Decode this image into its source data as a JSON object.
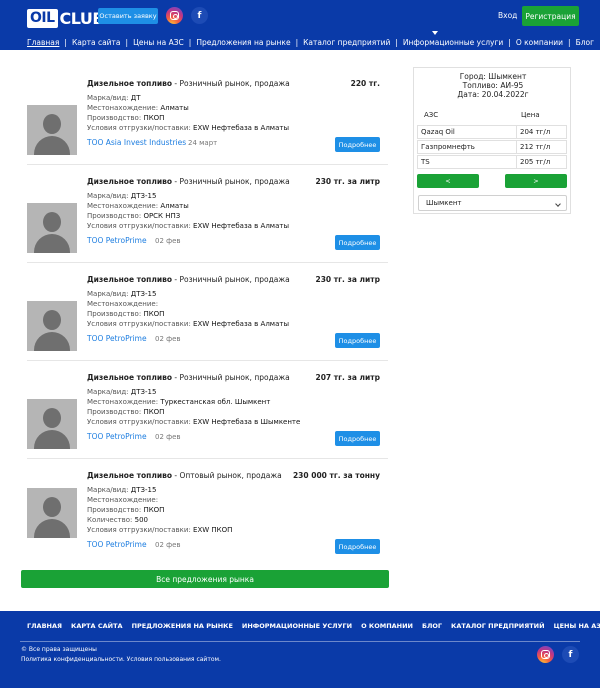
{
  "header": {
    "logo_oil": "OIL",
    "logo_club": "CLUB",
    "request_button": "Оставить заявку",
    "login_link": "Вход",
    "register_button": "Регистрация",
    "facebook_glyph": "f"
  },
  "nav": {
    "items": [
      {
        "label": "Главная",
        "active": true
      },
      {
        "label": "Карта сайта"
      },
      {
        "label": "Цены на АЗС"
      },
      {
        "label": "Предложения на рынке"
      },
      {
        "label": "Каталог предприятий"
      },
      {
        "label": "Информационные услуги"
      },
      {
        "label": "О компании"
      },
      {
        "label": "Блог"
      }
    ],
    "separator": "|"
  },
  "listings": [
    {
      "product": "Дизельное топливо",
      "market": " - Розничный рынок, продажа",
      "price": "220 тг.",
      "lines": [
        {
          "label": "Марка/вид: ",
          "value": "ДТ"
        },
        {
          "label": "Местонахождение: ",
          "value": "Алматы"
        },
        {
          "label": "Производство: ",
          "value": "ПКОП"
        },
        {
          "label": "Условия отгрузки/поставки: ",
          "value": "EXW Нефтебаза в Алматы"
        }
      ],
      "company": "ТОО Asia Invest Industries",
      "date": "24 март",
      "more": "Подробнее"
    },
    {
      "product": "Дизельное топливо",
      "market": " - Розничный рынок, продажа",
      "price": "230 тг. за литр",
      "lines": [
        {
          "label": "Марка/вид: ",
          "value": "ДТЗ-15"
        },
        {
          "label": "Местонахождение: ",
          "value": "Алматы"
        },
        {
          "label": "Производство: ",
          "value": "ОРСК НПЗ"
        },
        {
          "label": "Условия отгрузки/поставки: ",
          "value": "EXW Нефтебаза в Алматы"
        }
      ],
      "company": "ТОО PetroPrime",
      "date": "02 фев",
      "more": "Подробнее"
    },
    {
      "product": "Дизельное топливо",
      "market": " - Розничный рынок, продажа",
      "price": "230 тг. за литр",
      "lines": [
        {
          "label": "Марка/вид: ",
          "value": "ДТЗ-15"
        },
        {
          "label": "Местонахождение: ",
          "value": ""
        },
        {
          "label": "Производство: ",
          "value": "ПКОП"
        },
        {
          "label": "Условия отгрузки/поставки: ",
          "value": "EXW Нефтебаза в Алматы"
        }
      ],
      "company": "ТОО PetroPrime",
      "date": "02 фев",
      "more": "Подробнее"
    },
    {
      "product": "Дизельное топливо",
      "market": " - Розничный рынок, продажа",
      "price": "207 тг. за литр",
      "lines": [
        {
          "label": "Марка/вид: ",
          "value": "ДТЗ-15"
        },
        {
          "label": "Местонахождение: ",
          "value": "Туркестанская обл.  Шымкент"
        },
        {
          "label": "Производство: ",
          "value": "ПКОП"
        },
        {
          "label": "Условия отгрузки/поставки: ",
          "value": "EXW Нефтебаза в Шымкенте"
        }
      ],
      "company": "ТОО PetroPrime",
      "date": "02 фев",
      "more": "Подробнее"
    },
    {
      "product": "Дизельное топливо",
      "market": " - Оптовый рынок, продажа",
      "price": "230 000 тг. за тонну",
      "lines": [
        {
          "label": "Марка/вид: ",
          "value": "ДТЗ-15"
        },
        {
          "label": "Местонахождение: ",
          "value": ""
        },
        {
          "label": "Производство: ",
          "value": "ПКОП"
        },
        {
          "label": "Количество: ",
          "value": "500"
        },
        {
          "label": "Условия отгрузки/поставки: ",
          "value": "EXW ПКОП"
        }
      ],
      "company": "ТОО PetroPrime",
      "date": "02 фев",
      "more": "Подробнее"
    }
  ],
  "all_offers_button": "Все предложения рынка",
  "widget": {
    "city": "Город: Шымкент",
    "fuel": "Топливо: АИ-95",
    "date": "Дата: 20.04.2022г",
    "col_station": "АЗС",
    "col_price": "Цена",
    "rows": [
      {
        "station": "Qazaq Oil",
        "price": "204 тг/л"
      },
      {
        "station": "Газпромнефть",
        "price": "212 тг/л"
      },
      {
        "station": "TS",
        "price": "205 тг/л"
      }
    ],
    "prev_label": "<",
    "next_label": ">",
    "city_select": "Шымкент"
  },
  "footer": {
    "nav": [
      "ГЛАВНАЯ",
      "КАРТА САЙТА",
      "ПРЕДЛОЖЕНИЯ НА РЫНКЕ",
      "ИНФОРМАЦИОННЫЕ УСЛУГИ",
      "О КОМПАНИИ",
      "БЛОГ",
      "КАТАЛОГ ПРЕДПРИЯТИЙ",
      "ЦЕНЫ НА АЗС"
    ],
    "copyright": "© Все права защищены",
    "policy": "Политика конфиденциальности. Условия пользования сайтом."
  },
  "colors": {
    "brand_blue": "#0a3aa8",
    "accent_blue": "#1e8fe6",
    "green": "#1aa236",
    "link": "#1e7ee0"
  }
}
